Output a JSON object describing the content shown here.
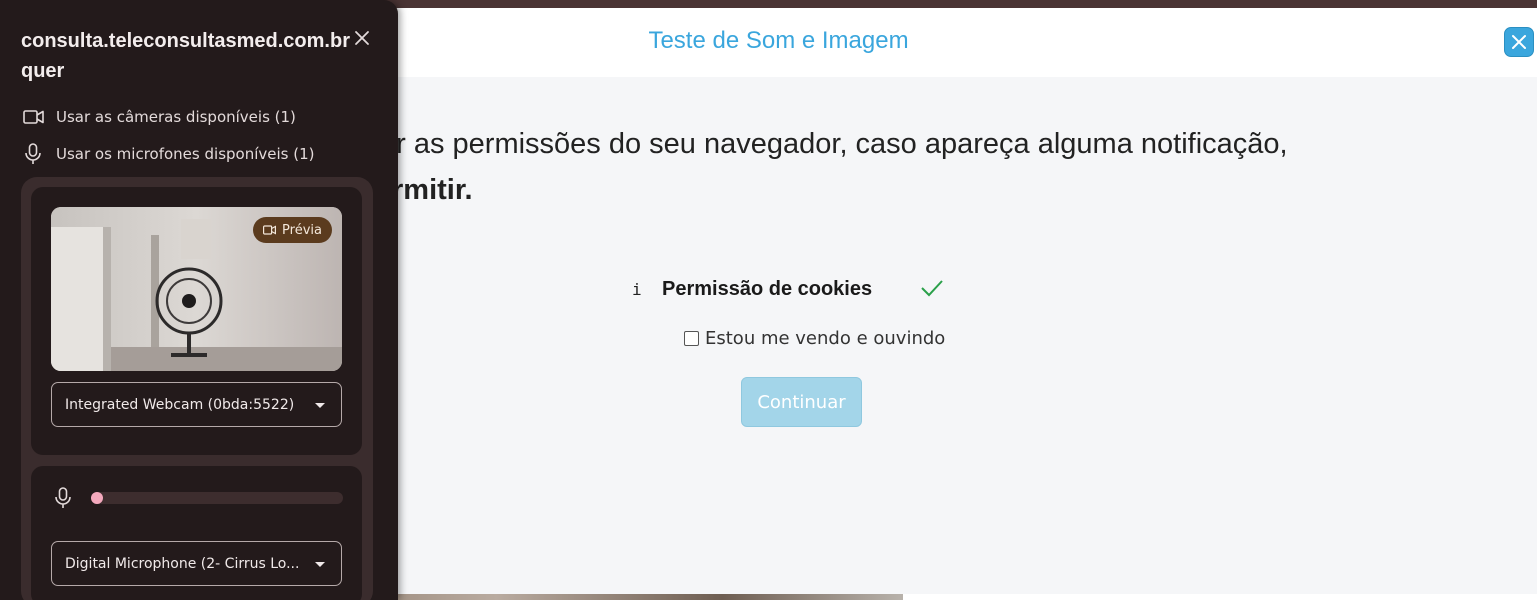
{
  "modal": {
    "title": "Teste de Som e Imagem",
    "intro_line1": "ar as permissões do seu navegador, caso apareça alguma notificação,",
    "intro_line2": "rmitir.",
    "cookie_info_icon": "i",
    "cookie_label": "Permissão de cookies",
    "checkbox_label": "Estou me vendo e ouvindo",
    "checkbox_checked": false,
    "continue_label": "Continuar",
    "accent_color": "#3aa6dd",
    "check_color": "#2aa04a"
  },
  "popup": {
    "title": "consulta.teleconsultasmed.com.br quer",
    "permissions": [
      {
        "icon": "video-camera-icon",
        "label": "Usar as câmeras disponíveis (1)"
      },
      {
        "icon": "microphone-icon",
        "label": "Usar os microfones disponíveis (1)"
      }
    ],
    "camera": {
      "preview_badge": "Prévia",
      "selected_device": "Integrated Webcam (0bda:5522)"
    },
    "microphone": {
      "level": 0.0,
      "selected_device": "Digital Microphone (2- Cirrus Lo..."
    }
  }
}
